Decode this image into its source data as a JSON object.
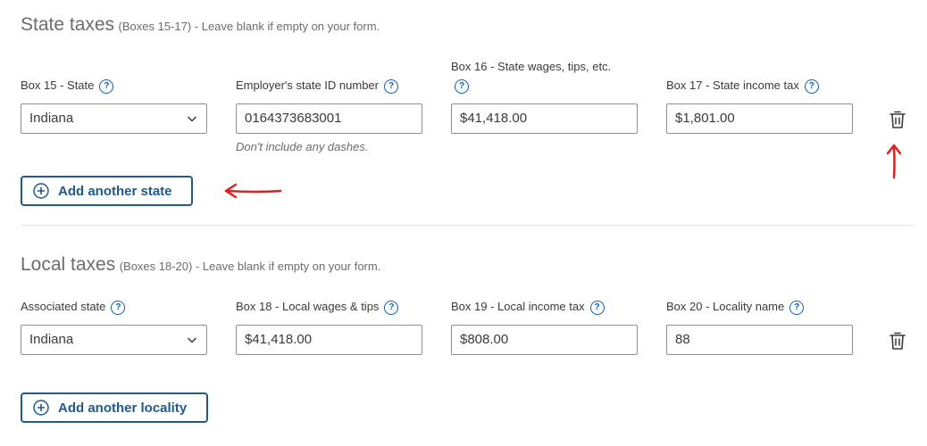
{
  "state": {
    "title": "State taxes",
    "subtitle": "(Boxes 15-17) - Leave blank if empty on your form.",
    "box15_label": "Box 15 - State",
    "box15_value": "Indiana",
    "employer_id_label": "Employer's state ID number",
    "employer_id_value": "0164373683001",
    "employer_id_hint": "Don't include any dashes.",
    "box16_label": "Box 16 - State wages, tips, etc.",
    "box16_value": "$41,418.00",
    "box17_label": "Box 17 - State income tax",
    "box17_value": "$1,801.00",
    "add_label": "Add another state"
  },
  "local": {
    "title": "Local taxes",
    "subtitle": "(Boxes 18-20) - Leave blank if empty on your form.",
    "assoc_label": "Associated state",
    "assoc_value": "Indiana",
    "box18_label": "Box 18 - Local wages & tips",
    "box18_value": "$41,418.00",
    "box19_label": "Box 19 - Local income tax",
    "box19_value": "$808.00",
    "box20_label": "Box 20 - Locality name",
    "box20_value": "88",
    "add_label": "Add another locality"
  },
  "help_glyph": "?",
  "colors": {
    "link_blue": "#21598d",
    "help_blue": "#0d5fb0",
    "annotation_red": "#e02020"
  }
}
